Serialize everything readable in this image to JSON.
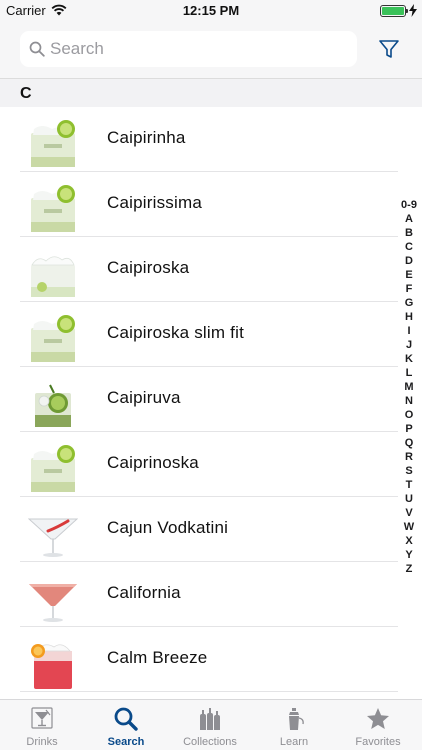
{
  "status_bar": {
    "carrier": "Carrier",
    "time": "12:15 PM",
    "battery_level": 1.0
  },
  "search": {
    "placeholder": "Search",
    "value": ""
  },
  "section": {
    "letter": "C"
  },
  "drinks": [
    {
      "name": "Caipirinha",
      "thumb": "lime-rocks-glass-icon"
    },
    {
      "name": "Caipirissima",
      "thumb": "lime-rocks-glass-icon"
    },
    {
      "name": "Caipiroska",
      "thumb": "crushed-ice-glass-icon"
    },
    {
      "name": "Caipiroska slim fit",
      "thumb": "lime-rocks-glass-icon"
    },
    {
      "name": "Caipiruva",
      "thumb": "grape-glass-icon"
    },
    {
      "name": "Caiprinoska",
      "thumb": "lime-rocks-glass-icon"
    },
    {
      "name": "Cajun Vodkatini",
      "thumb": "martini-glass-icon"
    },
    {
      "name": "California",
      "thumb": "pink-martini-glass-icon"
    },
    {
      "name": "Calm Breeze",
      "thumb": "red-highball-glass-icon"
    }
  ],
  "alphabet_index": [
    "0-9",
    "A",
    "B",
    "C",
    "D",
    "E",
    "F",
    "G",
    "H",
    "I",
    "J",
    "K",
    "L",
    "M",
    "N",
    "O",
    "P",
    "Q",
    "R",
    "S",
    "T",
    "U",
    "V",
    "W",
    "X",
    "Y",
    "Z"
  ],
  "tabs": [
    {
      "label": "Drinks",
      "icon": "cocktail-glass-icon",
      "active": false
    },
    {
      "label": "Search",
      "icon": "search-icon",
      "active": true
    },
    {
      "label": "Collections",
      "icon": "bottles-icon",
      "active": false
    },
    {
      "label": "Learn",
      "icon": "shaker-icon",
      "active": false
    },
    {
      "label": "Favorites",
      "icon": "star-icon",
      "active": false
    }
  ],
  "colors": {
    "accent": "#0a4a8a",
    "inactive_tab": "#8e8e93",
    "battery": "#3ac159"
  }
}
